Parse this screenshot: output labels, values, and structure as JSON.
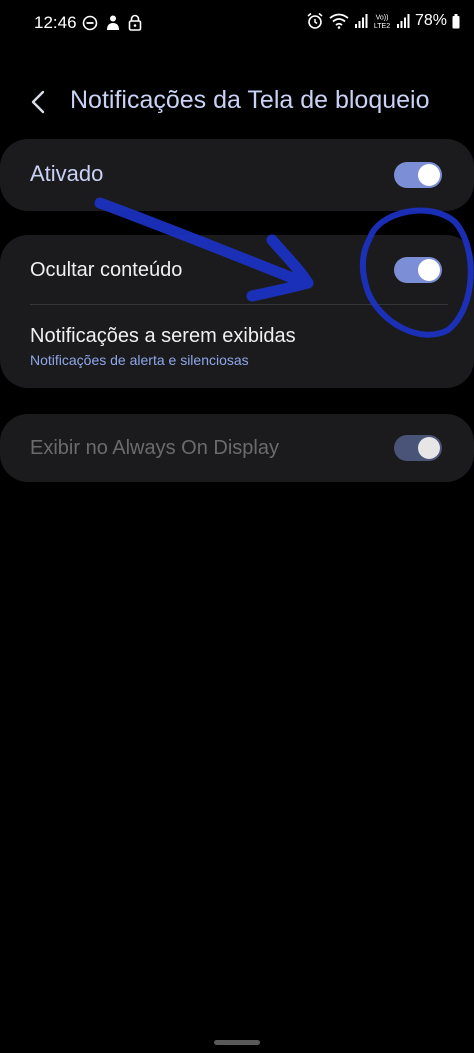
{
  "status_bar": {
    "time": "12:46",
    "battery": "78%",
    "left_icons": [
      "do-not-disturb-icon",
      "person-icon",
      "lock-icon"
    ],
    "right_icons": [
      "alarm-icon",
      "wifi-icon",
      "signal-icon",
      "volte-icon",
      "signal-icon",
      "battery-icon"
    ]
  },
  "header": {
    "back_icon": "chevron-left-icon",
    "title": "Notificações da Tela de bloqueio"
  },
  "main_toggle": {
    "label": "Ativado",
    "on": true
  },
  "options": {
    "hide_content": {
      "label": "Ocultar conteúdo",
      "on": true
    },
    "notifications_to_show": {
      "label": "Notificações a serem exibidas",
      "value": "Notificações de alerta e silenciosas"
    }
  },
  "aod": {
    "label": "Exibir no Always On Display",
    "on": true,
    "enabled": false
  },
  "annotation": {
    "color": "#1c33c9",
    "shapes": [
      "arrow",
      "circle"
    ]
  },
  "colors": {
    "accent": "#7c8fd6",
    "title": "#c9d2f5",
    "subtext": "#8fa6ea",
    "card": "#1b1b1d"
  }
}
